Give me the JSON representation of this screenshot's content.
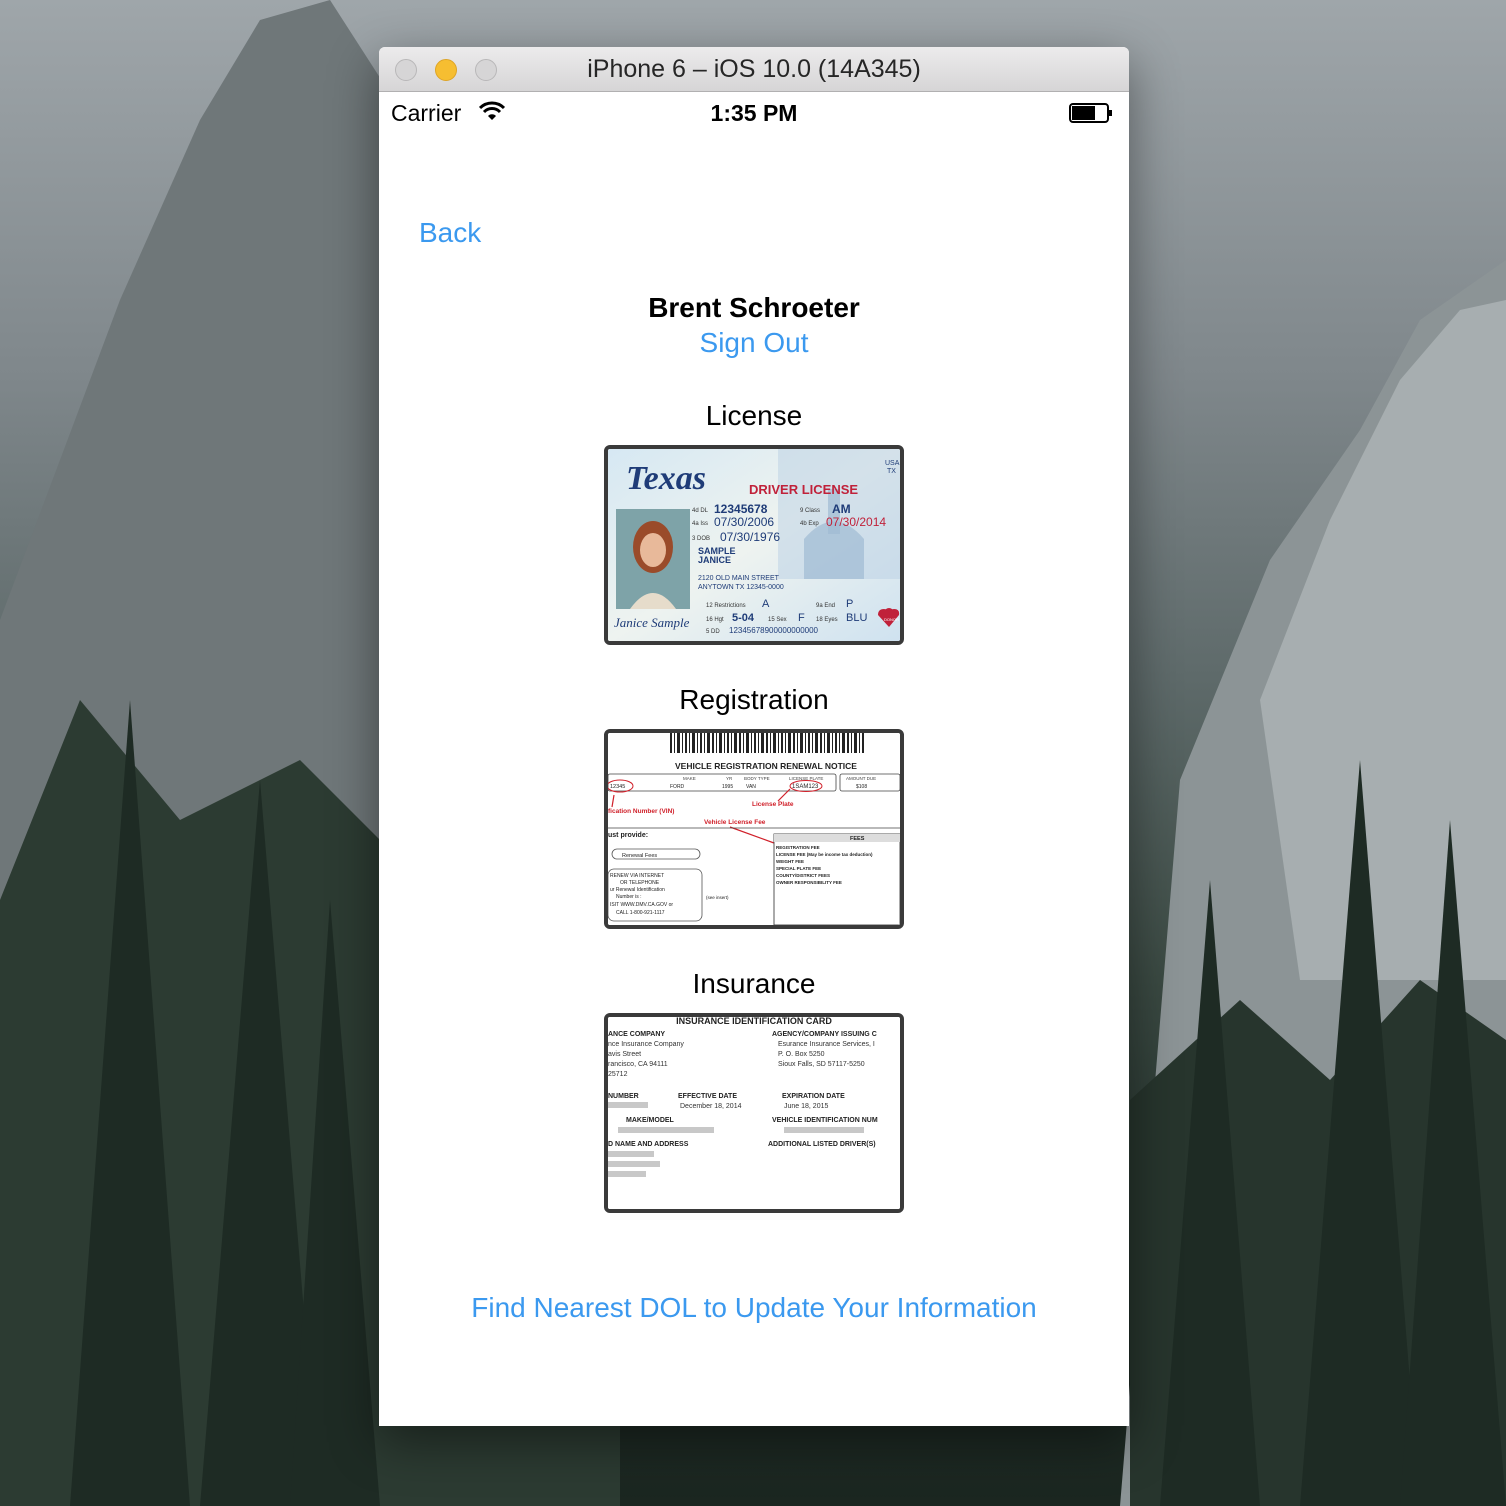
{
  "window": {
    "title": "iPhone 6 – iOS 10.0 (14A345)"
  },
  "status_bar": {
    "carrier": "Carrier",
    "time": "1:35 PM"
  },
  "nav": {
    "back_label": "Back"
  },
  "profile": {
    "name": "Brent Schroeter",
    "sign_out_label": "Sign Out"
  },
  "documents": {
    "license": {
      "label": "License",
      "state": "Texas",
      "country": "USA",
      "state_abbr": "TX",
      "heading": "DRIVER LICENSE",
      "dl_label": "4d DL",
      "dl": "12345678",
      "class_label": "9 Class",
      "class": "AM",
      "iss_label": "4a Iss",
      "iss": "07/30/2006",
      "exp_label": "4b Exp",
      "exp": "07/30/2014",
      "dob_label": "3 DOB",
      "dob": "07/30/1976",
      "name_last": "SAMPLE",
      "name_first": "JANICE",
      "address_1": "2120 OLD MAIN STREET",
      "address_2": "ANYTOWN TX 12345-0000",
      "restrictions_label": "12 Restrictions",
      "restrictions": "A",
      "end_label": "9a End",
      "end": "P",
      "hgt_label": "16 Hgt",
      "hgt": "5-04",
      "sex_label": "15 Sex",
      "sex": "F",
      "eyes_label": "18 Eyes",
      "eyes": "BLU",
      "dd_label": "5 DD",
      "dd": "12345678900000000000",
      "signature": "Janice Sample",
      "donor": "DONOR"
    },
    "registration": {
      "label": "Registration",
      "title": "VEHICLE REGISTRATION RENEWAL NOTICE",
      "col_make": "MAKE",
      "col_yr": "YR",
      "col_body": "BODY TYPE",
      "col_plate": "LICENSE PLATE",
      "col_amount": "AMOUNT DUE",
      "vin": "12345",
      "make": "FORD",
      "year": "1995",
      "body": "VAN",
      "plate": "1SAM123",
      "amount": "$108",
      "note_vin": "fication Number (VIN)",
      "note_plate": "License Plate",
      "note_fee": "Vehicle License Fee",
      "provide": "ust provide:",
      "renewal_fees": "Renewal Fees",
      "fees_header": "FEES",
      "fee_lines": [
        "REGISTRATION FEE",
        "LICENSE FEE (May be income tax deduction)",
        "WEIGHT FEE",
        "SPECIAL PLATE FEE",
        "COUNTY/DISTRICT FEES",
        "OWNER RESPONSIBILITY FEE"
      ],
      "renew_lines": [
        "RENEW VIA INTERNET",
        "OR TELEPHONE",
        "ur Renewal Identification",
        "Number is :",
        "ISIT WWW.DMV.CA.GOV or",
        "CALL 1-800-921-1117"
      ],
      "see_insert": "(see insert)"
    },
    "insurance": {
      "label": "Insurance",
      "title": "INSURANCE IDENTIFICATION CARD",
      "company_header": "ANCE COMPANY",
      "company_lines": [
        "nce Insurance Company",
        "avis Street",
        "rancisco, CA 94111",
        "25712"
      ],
      "agency_header": "AGENCY/COMPANY ISSUING C",
      "agency_lines": [
        "Esurance Insurance Services, I",
        "P. O. Box 5250",
        "Sioux Falls, SD 57117-5250"
      ],
      "number_header": "NUMBER",
      "effective_header": "EFFECTIVE DATE",
      "effective": "December 18, 2014",
      "expiration_header": "EXPIRATION DATE",
      "expiration": "June 18, 2015",
      "make_model": "MAKE/MODEL",
      "vin_header": "VEHICLE IDENTIFICATION NUM",
      "name_address": "D NAME AND ADDRESS",
      "drivers": "ADDITIONAL LISTED DRIVER(S)"
    }
  },
  "footer": {
    "find_dol_label": "Find Nearest DOL to Update Your Information"
  }
}
